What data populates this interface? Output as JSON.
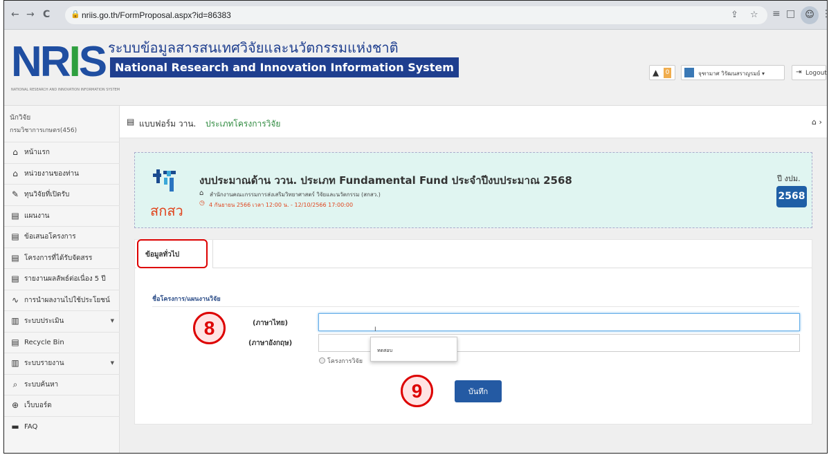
{
  "browser": {
    "url": "nriis.go.th/FormProposal.aspx?id=86383",
    "back_icon": "←",
    "forward_icon": "→",
    "reload_icon": "C",
    "lock_icon": "🔒",
    "share_icon": "⇪",
    "star_icon": "☆",
    "list_icon": "≡",
    "panel_icon": "□",
    "avatar_icon": "☺",
    "menu_icon": "⋮"
  },
  "header": {
    "logo_blue": "NR",
    "logo_green": "I",
    "logo_blue2": "S",
    "logo_subtitle": "NATIONAL RESEARCH AND INNOVATION INFORMATION SYSTEM",
    "title_thai": "ระบบข้อมูลสารสนเทศวิจัยและนวัตกรรมแห่งชาติ",
    "title_english": "National Research and Innovation Information System",
    "notification_icon": "▲",
    "notification_count": "0",
    "user_name": "จุฑามาศ วิรัฒนสราญรมย์ ▾",
    "logout_icon": "⇥",
    "logout_label": "Logout"
  },
  "sidebar": {
    "role": "นักวิจัย",
    "department": "กรมวิชาการเกษตร(456)",
    "items": [
      {
        "icon": "⌂",
        "label": "หน้าแรก",
        "caret": ""
      },
      {
        "icon": "⌂",
        "label": "หน่วยงานของท่าน",
        "caret": ""
      },
      {
        "icon": "✎",
        "label": "ทุนวิจัยที่เปิดรับ",
        "caret": ""
      },
      {
        "icon": "▤",
        "label": "แผนงาน",
        "caret": ""
      },
      {
        "icon": "▤",
        "label": "ข้อเสนอโครงการ",
        "caret": ""
      },
      {
        "icon": "▤",
        "label": "โครงการที่ได้รับจัดสรร",
        "caret": ""
      },
      {
        "icon": "▤",
        "label": "รายงานผลลัพธ์ต่อเนื่อง 5 ปี",
        "caret": ""
      },
      {
        "icon": "∿",
        "label": "การนำผลงานไปใช้ประโยชน์",
        "caret": ""
      },
      {
        "icon": "▥",
        "label": "ระบบประเมิน",
        "caret": "▼"
      },
      {
        "icon": "▤",
        "label": "Recycle Bin",
        "caret": ""
      },
      {
        "icon": "▥",
        "label": "ระบบรายงาน",
        "caret": "▼"
      },
      {
        "icon": "⌕",
        "label": "ระบบค้นหา",
        "caret": ""
      },
      {
        "icon": "⊕",
        "label": "เว็บบอร์ด",
        "caret": ""
      },
      {
        "icon": "▬",
        "label": "FAQ",
        "caret": ""
      }
    ]
  },
  "breadcrumb": {
    "icon": "▤",
    "prefix": "แบบฟอร์ม วาน.",
    "link": "ประเภทโครงการวิจัย",
    "home_icon": "⌂ ›"
  },
  "banner": {
    "org_name": "สกสว",
    "title": "งบประมาณด้าน ววน. ประเภท Fundamental Fund ประจำปีงบประมาณ 2568",
    "agency_icon": "⌂",
    "agency": "สำนักงานคณะกรรมการส่งเสริมวิทยาศาสตร์ วิจัยและนวัตกรรม (สกสว.)",
    "date_icon": "◷",
    "date_range": "4 กันยายน 2566 เวลา 12:00 น. - 12/10/2566 17:00:00",
    "year_label": "ปี งปม.",
    "year": "2568"
  },
  "form": {
    "tab_label": "ข้อมูลทั่วไป",
    "section_title": "ชื่อโครงการ/แผนงานวิจัย",
    "label_thai": "(ภาษาไทย)",
    "label_english": "(ภาษาอังกฤษ)",
    "input_thai_value": "",
    "input_english_value": "",
    "cursor_mark": "I",
    "radio_label": "โครงการวิจัย",
    "autocomplete_item": "ทดสอบ",
    "save_label": "บันทึก"
  },
  "annotations": {
    "step_8": "8",
    "step_9": "9"
  },
  "colors": {
    "brand_blue": "#1f3f8f",
    "brand_green": "#2e9f3f",
    "banner_bg": "#e0f5f1",
    "save_button": "#245aa3",
    "annotation_red": "#dd0000",
    "date_orange": "#e0441d"
  }
}
